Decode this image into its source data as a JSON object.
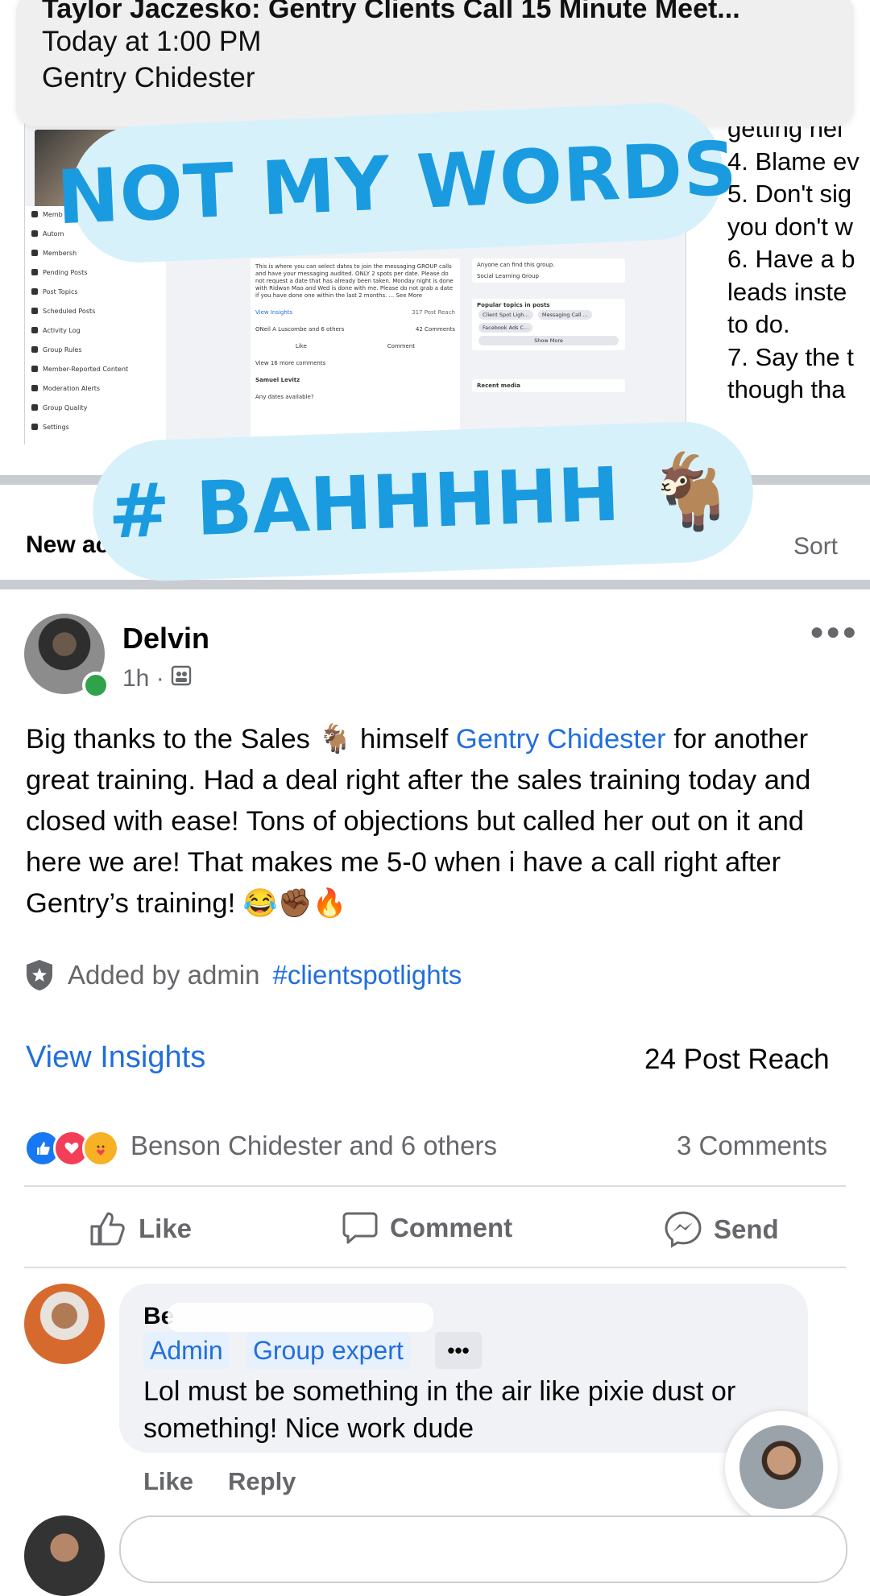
{
  "notification": {
    "title": "Taylor Jaczesko: Gentry Clients Call 15 Minute Meet...",
    "time": "Today at 1:00 PM",
    "author": "Gentry Chidester"
  },
  "background_screenshot": {
    "sidebar_items": [
      "Memb",
      "Autom",
      "Membersh",
      "Pending Posts",
      "Post Topics",
      "Scheduled Posts",
      "Activity Log",
      "Group Rules",
      "Member-Reported Content",
      "Moderation Alerts",
      "Group Quality",
      "Settings"
    ],
    "post_text": "This is where you can select dates to join the messaging GROUP calls and have your messaging audited. ONLY 2 spots per date. Please do not request a date that has already been taken. Monday night is done with Ridwan Mao and Wed is done with me. Please do not grab a date if you have done one within the last 2 months. ... See More",
    "view_insights": "View Insights",
    "post_reach": "317 Post Reach",
    "reactions_text": "ONeil A Luscombe and 6 others",
    "comments": "42 Comments",
    "like": "Like",
    "comment": "Comment",
    "view_more_comments": "View 16 more comments",
    "commenter": "Samuel Levitz",
    "comment_text": "Any dates available?",
    "right_visible": "Anyone can find this group.",
    "right_group": "Social Learning Group",
    "popular_topics": "Popular topics in posts",
    "topic_chips": [
      "Client Spot Ligh...",
      "Messaging Call ...",
      "Facebook Ads C..."
    ],
    "show_more": "Show More",
    "recent_media": "Recent media"
  },
  "right_text_lines": [
    "getting hel",
    "4. Blame ev",
    "5. Don't sig",
    "you don't w",
    "6. Have a b",
    "leads inste",
    "to do.",
    "7. Say the t",
    "though tha"
  ],
  "stickers": {
    "first": "NOT MY WORDS",
    "second": "# BAHHHHH 🐐"
  },
  "section": {
    "new_label": "New ac",
    "sort_label": "Sort"
  },
  "post": {
    "author": "Delvin D",
    "time": "1h ·",
    "body_part1": "Big thanks to the Sales 🐐 himself ",
    "mention": "Gentry Chidester",
    "body_part2": " for another great training. Had a deal right after the sales training today and closed with ease! Tons of objections but called her out on it and here we are! That makes me 5-0 when i have a call right after Gentry’s training! 😂✊🏾🔥",
    "added_by": "Added by admin",
    "hashtag": "#clientspotlights",
    "view_insights": "View Insights",
    "post_reach": "24 Post Reach",
    "reactions_text": "Benson Chidester and 6 others",
    "comments_count": "3 Comments",
    "actions": {
      "like": "Like",
      "comment": "Comment",
      "send": "Send"
    }
  },
  "comment": {
    "author": "Be",
    "badges": [
      "Admin",
      "Group expert"
    ],
    "more": "•••",
    "text": "Lol must be something in the air like pixie dust or something! Nice work dude",
    "like": "Like",
    "reply": "Reply"
  },
  "icons": {
    "post_more": "more-dots-icon",
    "shield": "shield-star-icon",
    "like": "thumbs-up-icon",
    "comment": "speech-bubble-icon",
    "send": "messenger-icon"
  },
  "colors": {
    "link_blue": "#216fdb",
    "sticker_bg": "#d7f1fb",
    "sticker_text": "#1a9be0",
    "online_green": "#31a24c"
  }
}
